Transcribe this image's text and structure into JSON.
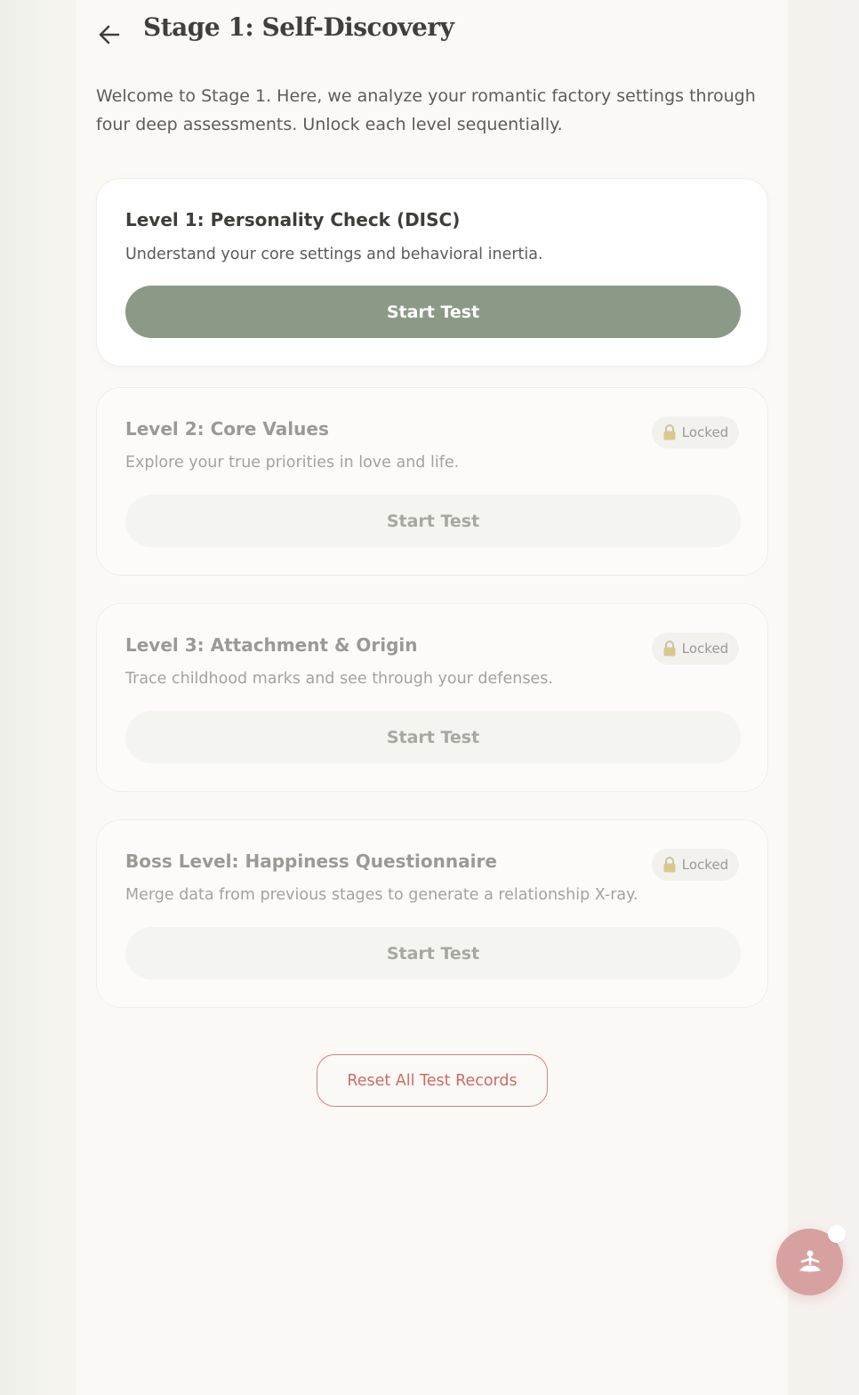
{
  "header": {
    "title": "Stage 1: Self-Discovery",
    "back_icon": "arrow-left-icon"
  },
  "intro": "Welcome to Stage 1. Here, we analyze your romantic factory settings through four deep assessments. Unlock each level sequentially.",
  "levels": [
    {
      "title": "Level 1: Personality Check (DISC)",
      "description": "Understand your core settings and behavioral inertia.",
      "button_label": "Start Test",
      "locked": false
    },
    {
      "title": "Level 2: Core Values",
      "description": "Explore your true priorities in love and life.",
      "button_label": "Start Test",
      "locked": true,
      "badge": "Locked"
    },
    {
      "title": "Level 3: Attachment & Origin",
      "description": "Trace childhood marks and see through your defenses.",
      "button_label": "Start Test",
      "locked": true,
      "badge": "Locked"
    },
    {
      "title": "Boss Level: Happiness Questionnaire",
      "description": "Merge data from previous stages to generate a relationship X-ray.",
      "button_label": "Start Test",
      "locked": true,
      "badge": "Locked"
    }
  ],
  "reset_label": "Reset All Test Records",
  "fab": {
    "icon": "meditation-icon"
  },
  "colors": {
    "primary_button": "#8a9a86",
    "reset_accent": "#cf6b63",
    "fab": "#d8a1a1",
    "background": "#faf9f6"
  }
}
